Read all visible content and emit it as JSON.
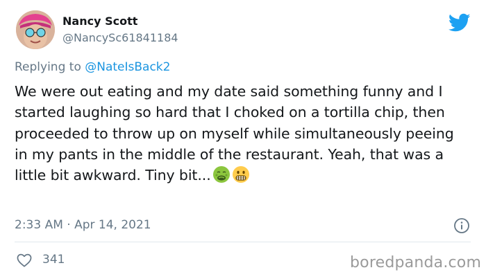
{
  "author": {
    "display_name": "Nancy Scott",
    "handle": "@NancySc61841184"
  },
  "reply": {
    "prefix": "Replying to ",
    "mention": "@NateIsBack2"
  },
  "tweet": {
    "text": "We were out eating and my date said something funny and I started laughing so hard that I choked on a tortilla chip, then proceeded to throw up on myself while simultaneously peeing in my pants in the middle of the restaurant. Yeah, that was a little bit awkward. Tiny bit...",
    "emojis": [
      "nauseated-face",
      "grimacing-face"
    ]
  },
  "meta": {
    "timestamp": "2:33 AM · Apr 14, 2021"
  },
  "actions": {
    "like_count": "341"
  },
  "watermark": "boredpanda.com",
  "colors": {
    "twitter_blue": "#1da1f2",
    "mention_blue": "#1b95e0",
    "secondary_text": "#657786",
    "primary_text": "#14171a"
  },
  "icons": {
    "brand": "twitter-bird-icon",
    "info": "info-icon",
    "like": "heart-icon"
  }
}
